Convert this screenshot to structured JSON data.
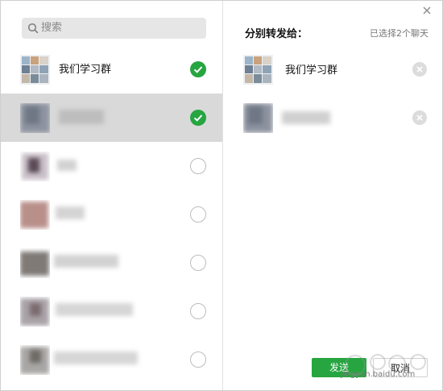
{
  "search": {
    "placeholder": "搜索",
    "icon": "search-icon"
  },
  "left_list": [
    {
      "name": "我们学习群",
      "selected": true
    },
    {
      "name": "",
      "selected": true
    },
    {
      "name": "",
      "selected": false
    },
    {
      "name": "",
      "selected": false
    },
    {
      "name": "",
      "selected": false
    },
    {
      "name": "",
      "selected": false
    },
    {
      "name": "",
      "selected": false
    }
  ],
  "right_panel": {
    "title": "分别转发给：",
    "count": "已选择2个聊天",
    "selected_items": [
      {
        "name": "我们学习群"
      },
      {
        "name": ""
      }
    ]
  },
  "buttons": {
    "send": "发送",
    "cancel": "取消"
  },
  "watermark": {
    "text": "jingyan.baidu.com"
  },
  "colors": {
    "accent": "#26a540",
    "selected_row": "#d9d9d9",
    "search_bg": "#e6e6e6"
  }
}
